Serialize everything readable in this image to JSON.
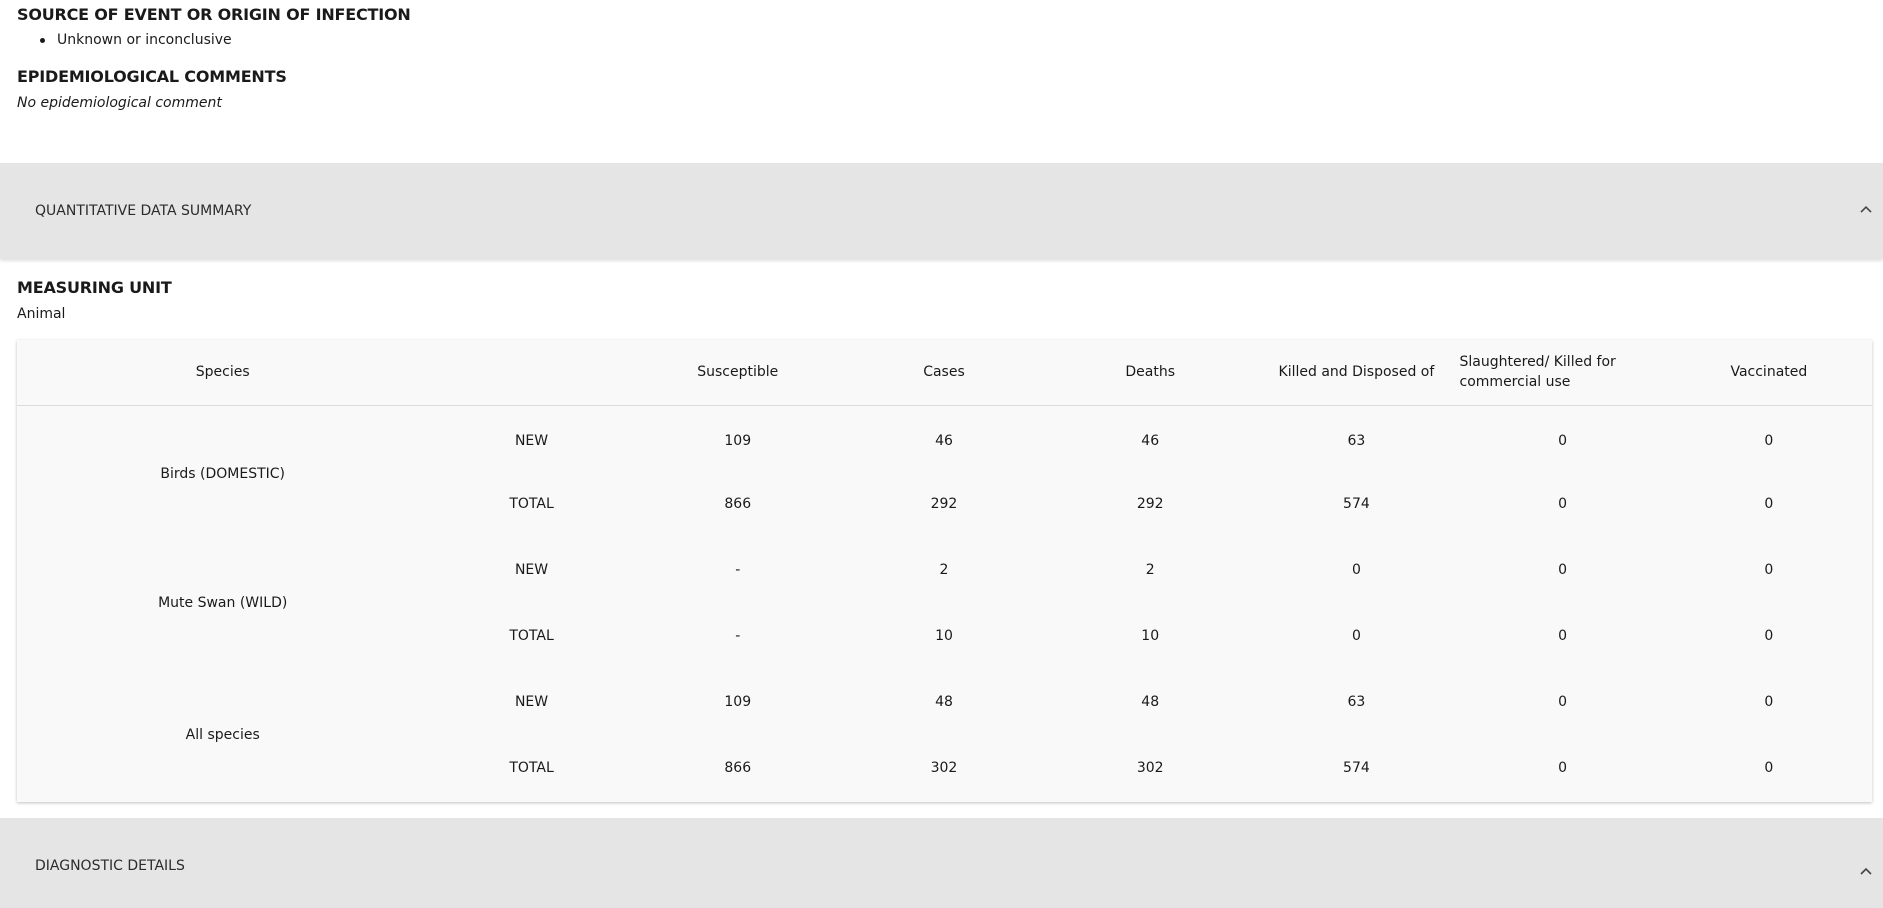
{
  "source": {
    "title": "SOURCE OF EVENT OR ORIGIN OF INFECTION",
    "items": [
      "Unknown or inconclusive"
    ]
  },
  "epi": {
    "title": "EPIDEMIOLOGICAL COMMENTS",
    "comment": "No epidemiological comment"
  },
  "quant_panel": {
    "label": "QUANTITATIVE DATA SUMMARY",
    "icon": "chevron-up-icon"
  },
  "measuring_unit": {
    "title": "MEASURING UNIT",
    "value": "Animal"
  },
  "table": {
    "headers": [
      "Species",
      "",
      "Susceptible",
      "Cases",
      "Deaths",
      "Killed and Disposed of",
      "Slaughtered/ Killed for commercial use",
      "Vaccinated"
    ],
    "groups": [
      {
        "species": "Birds (DOMESTIC)",
        "rows": [
          {
            "kind": "NEW",
            "values": [
              "109",
              "46",
              "46",
              "63",
              "0",
              "0"
            ]
          },
          {
            "kind": "TOTAL",
            "values": [
              "866",
              "292",
              "292",
              "574",
              "0",
              "0"
            ]
          }
        ]
      },
      {
        "species": "Mute Swan (WILD)",
        "rows": [
          {
            "kind": "NEW",
            "values": [
              "-",
              "2",
              "2",
              "0",
              "0",
              "0"
            ]
          },
          {
            "kind": "TOTAL",
            "values": [
              "-",
              "10",
              "10",
              "0",
              "0",
              "0"
            ]
          }
        ]
      },
      {
        "species": "All species",
        "rows": [
          {
            "kind": "NEW",
            "values": [
              "109",
              "48",
              "48",
              "63",
              "0",
              "0"
            ]
          },
          {
            "kind": "TOTAL",
            "values": [
              "866",
              "302",
              "302",
              "574",
              "0",
              "0"
            ]
          }
        ]
      }
    ]
  },
  "diag_panel": {
    "label": "DIAGNOSTIC DETAILS",
    "icon": "chevron-up-icon"
  }
}
